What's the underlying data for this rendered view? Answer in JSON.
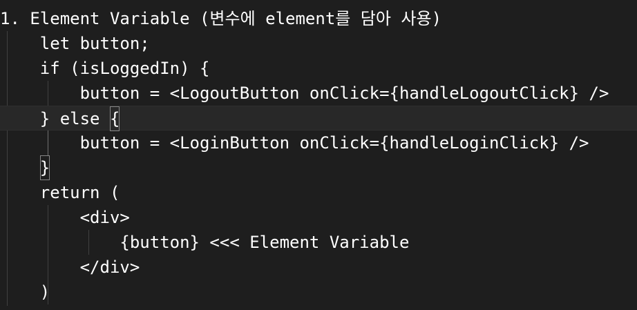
{
  "editor": {
    "lines": [
      {
        "indent": "",
        "text": "1. Element Variable (변수에 element를 담아 사용)"
      },
      {
        "indent": "    ",
        "text": "let button;"
      },
      {
        "indent": "    ",
        "text": "if (isLoggedIn) {"
      },
      {
        "indent": "        ",
        "text": "button = <LogoutButton onClick={handleLogoutClick} />"
      },
      {
        "indent": "    ",
        "pre": "} else ",
        "bracket": "{",
        "post": ""
      },
      {
        "indent": "        ",
        "text": "button = <LoginButton onClick={handleLoginClick} />"
      },
      {
        "indent": "    ",
        "pre": "",
        "bracket": "}",
        "post": ""
      },
      {
        "indent": "    ",
        "text": "return ("
      },
      {
        "indent": "        ",
        "text": "<div>"
      },
      {
        "indent": "            ",
        "text": "{button} <<< Element Variable"
      },
      {
        "indent": "        ",
        "text": "</div>"
      },
      {
        "indent": "    ",
        "text": ")"
      }
    ]
  },
  "colors": {
    "background": "#1e1e1e",
    "text": "#ffffff",
    "current_line": "#282828",
    "indent_guide": "#404040",
    "active_indent_guide": "#707070",
    "bracket_match_border": "#888888"
  }
}
